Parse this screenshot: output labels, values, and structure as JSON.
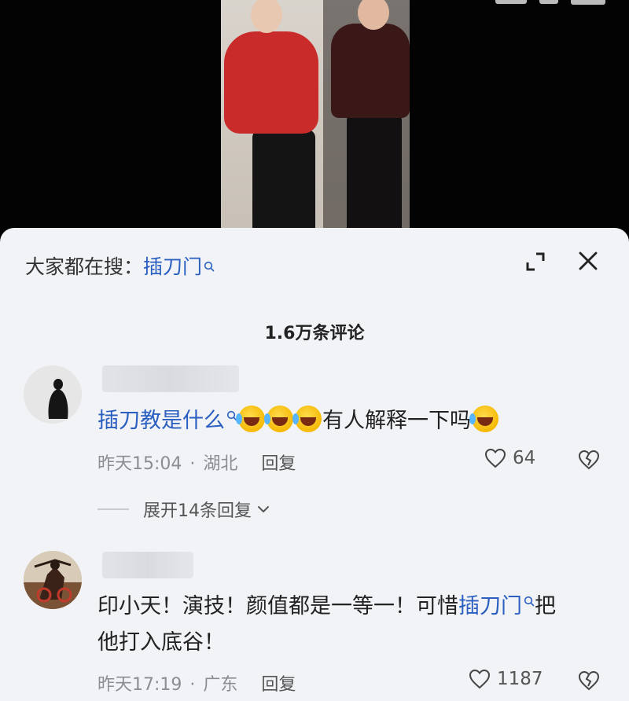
{
  "status_bar": {
    "time": ""
  },
  "search_hint": {
    "prefix": "大家都在搜：",
    "keyword": "插刀门"
  },
  "comments_header": {
    "count_label": "1.6万条评论"
  },
  "comments": [
    {
      "text_link": "插刀教是什么",
      "text_rest": "有人解释一下吗",
      "time": "昨天15:04",
      "location": "湖北",
      "reply_label": "回复",
      "likes": "64",
      "expand_label": "展开14条回复"
    },
    {
      "line1_prefix": "印小天！演技！颜值都是一等一！可惜",
      "line1_link": "插刀门",
      "line1_suffix": "把",
      "line2": "他打入底谷！",
      "time": "昨天17:19",
      "location": "广东",
      "reply_label": "回复",
      "likes": "1187"
    }
  ],
  "icons": {
    "search": "search-icon",
    "expand": "expand-icon",
    "close": "close-icon",
    "like": "heart-icon",
    "dislike": "broken-heart-icon",
    "emoji": "rolling-laughing-emoji"
  },
  "colors": {
    "link": "#2a5fc0",
    "panel_bg": "#f1f3f7",
    "meta": "#8a8d93"
  }
}
